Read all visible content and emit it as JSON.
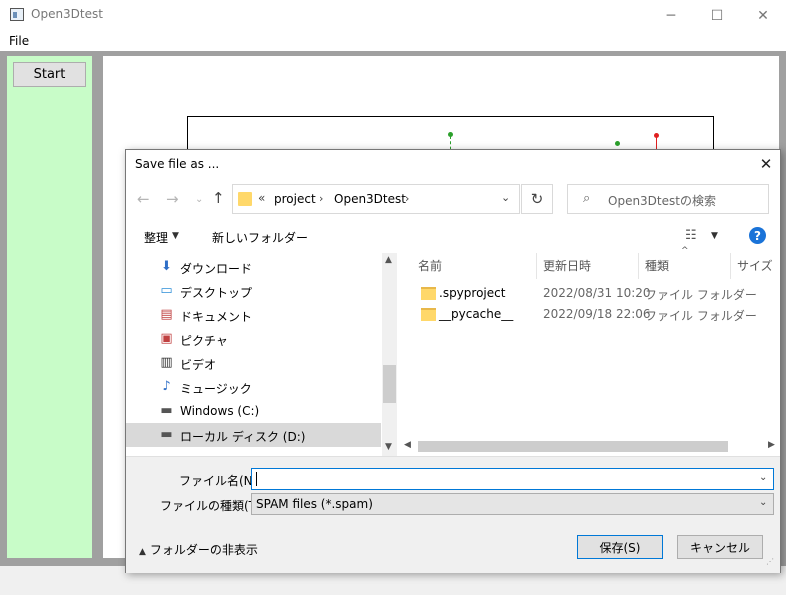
{
  "app": {
    "title": "Open3Dtest",
    "menu": [
      "File"
    ],
    "start_label": "Start"
  },
  "dialog": {
    "title": "Save file as ...",
    "close_glyph": "✕",
    "address": {
      "chevrons": "«",
      "segments": [
        "project",
        "Open3Dtest"
      ],
      "separator": "›"
    },
    "search_placeholder": "Open3Dtestの検索",
    "toolbar": {
      "organize": "整理",
      "new_folder": "新しいフォルダー"
    },
    "nav_items": [
      {
        "label": "ダウンロード",
        "icon": "download-icon"
      },
      {
        "label": "デスクトップ",
        "icon": "desktop-icon"
      },
      {
        "label": "ドキュメント",
        "icon": "documents-icon"
      },
      {
        "label": "ピクチャ",
        "icon": "pictures-icon"
      },
      {
        "label": "ビデオ",
        "icon": "video-icon"
      },
      {
        "label": "ミュージック",
        "icon": "music-icon"
      },
      {
        "label": "Windows (C:)",
        "icon": "drive-icon"
      },
      {
        "label": "ローカル ディスク (D:)",
        "icon": "drive-icon"
      }
    ],
    "columns": [
      "名前",
      "更新日時",
      "種類",
      "サイズ"
    ],
    "files": [
      {
        "name": ".spyproject",
        "date": "2022/08/31 10:20",
        "type": "ファイル フォルダー"
      },
      {
        "name": "__pycache__",
        "date": "2022/09/18 22:06",
        "type": "ファイル フォルダー"
      }
    ],
    "filename_label": "ファイル名(N):",
    "filename_value": "",
    "filetype_label": "ファイルの種類(T):",
    "filetype_value": "SPAM files (*.spam)",
    "hide_folders": "フォルダーの非表示",
    "save_label": "保存(S)",
    "cancel_label": "キャンセル"
  },
  "colors": {
    "side_panel": "#c8fcc8",
    "accent": "#0078d7",
    "plot_green": "#2ca02c",
    "plot_red": "#e02020"
  }
}
